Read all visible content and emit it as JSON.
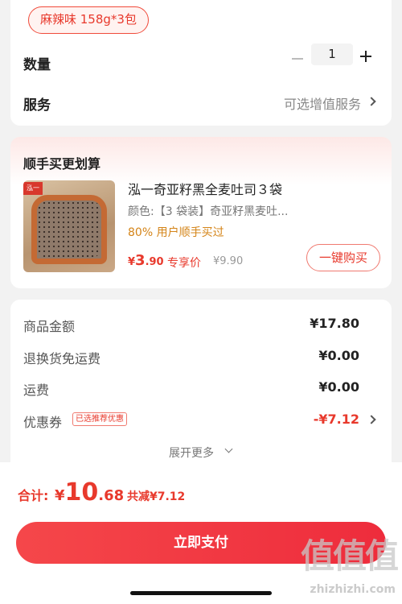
{
  "spec": {
    "selected": "麻辣味 158g*3包"
  },
  "quantity": {
    "label": "数量",
    "value": "1"
  },
  "service": {
    "label": "服务",
    "value": "可选增值服务"
  },
  "addon": {
    "title": "顺手买更划算",
    "thumb_tag": "泓一",
    "product": {
      "name": "泓一奇亚籽黑全麦吐司３袋",
      "variant": "颜色:【3 袋装】奇亚籽黑麦吐...",
      "social_proof": "80% 用户顺手买过",
      "price_symbol": "¥",
      "price_int": "3",
      "price_dec": ".90",
      "price_tag": "专享价",
      "original_price": "¥9.90",
      "buy_label": "一键购买"
    }
  },
  "summary": {
    "rows": [
      {
        "label": "商品金额",
        "value": "¥17.80"
      },
      {
        "label": "退换货免运费",
        "value": "¥0.00"
      },
      {
        "label": "运费",
        "value": "¥0.00"
      },
      {
        "label": "优惠券",
        "tag": "已选推荐优惠",
        "value": "-¥7.12"
      }
    ],
    "expand_label": "展开更多"
  },
  "footer": {
    "total_label": "合计:",
    "total_symbol": "¥",
    "total_int": "10",
    "total_dec": ".68",
    "saved": "共减¥7.12",
    "pay_label": "立即支付"
  },
  "watermark": {
    "text": "值值值",
    "url": "zhizhizhi.com"
  },
  "colors": {
    "accent": "#e8392c",
    "social": "#d48418",
    "background": "#f2f2f2"
  }
}
